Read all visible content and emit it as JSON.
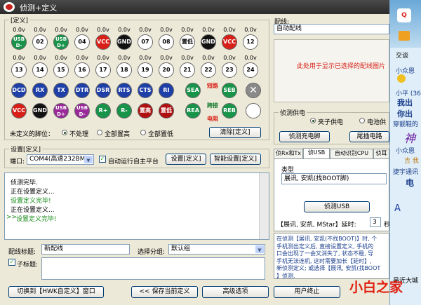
{
  "window": {
    "title": "侦测+定义",
    "close_label": "✕"
  },
  "define_group": {
    "legend": "[定义]"
  },
  "pins_row1": {
    "voltages": [
      "0.0v",
      "0.0v",
      "0.0v",
      "0.0v",
      "0.0v",
      "0.0v",
      "0.0v",
      "0.0v",
      "0.0v",
      "0.0v",
      "0.0v",
      "0.0v"
    ],
    "labels": [
      "USB\nD-",
      "02",
      "USB\nD+",
      "04",
      "VCC",
      "GND",
      "07",
      "08",
      "置低",
      "GND",
      "VCC",
      "12"
    ]
  },
  "pins_row2": {
    "voltages": [
      "0.0v",
      "0.0v",
      "0.0v",
      "0.0v",
      "0.0v",
      "0.0v",
      "0.0v",
      "0.0v",
      "0.0v",
      "0.0v",
      "0.0v",
      "0.0v"
    ],
    "labels": [
      "13",
      "14",
      "15",
      "16",
      "17",
      "18",
      "19",
      "20",
      "21",
      "22",
      "23",
      "24"
    ]
  },
  "signals_row1": [
    "DCD",
    "RX",
    "TX",
    "DTR",
    "DSR",
    "RTS",
    "CTS",
    "RI",
    "SEA",
    "SEB"
  ],
  "signals_row2": [
    "VCC",
    "GND",
    "USB\nD+",
    "USB\nD-",
    "R+",
    "R-",
    "置高",
    "置低",
    "REA",
    "REB"
  ],
  "badges": {
    "short": "短路",
    "bridge1": "跨接",
    "bridge2": "电阻"
  },
  "undefined_pins": {
    "label": "未定义的脚位：",
    "options": [
      "不处理",
      "全部置高",
      "全部置低"
    ],
    "selected": 0,
    "clear_button": "清除[定义]"
  },
  "settings": {
    "legend": "设置[定义]",
    "port_label": "端口:",
    "port_value": "COM4(高速232BM)",
    "auto_run_label": "自动运行自主平台",
    "set_button": "设置[定义]",
    "smart_button": "智能设置[定义]"
  },
  "log": [
    {
      "text": "侦测完毕.",
      "color": "#000000"
    },
    {
      "text": "正在设置定义...",
      "color": "#000000"
    },
    {
      "text": "设置定义完毕!",
      "color": "#1a8c1a"
    },
    {
      "text": "正在设置定义...",
      "color": "#000000"
    },
    {
      "text": "设置定义完毕!",
      "color": "#1a8c1a"
    }
  ],
  "log_prompt": ">>",
  "form": {
    "title_label": "配线标题:",
    "title_value": "新配线",
    "group_label": "选择分组:",
    "group_value": "默认组",
    "subtitle_label": "子标题:"
  },
  "bottom_buttons": {
    "switch": "切换到【HWK自定义】窗口",
    "save": "<< 保存当前定义",
    "advanced": "高级选项",
    "terminate": "用户终止"
  },
  "wiring": {
    "legend": "配线:",
    "value": "自动配线",
    "placeholder": "此处用于显示已选择的配线图片"
  },
  "power": {
    "legend": "侦测供电",
    "options": [
      "夹子供电",
      "电池供"
    ],
    "selected": 0,
    "detect_button": "侦测充电脚",
    "tail_button": "尾插电路"
  },
  "tabs": [
    "侦Rx和Tx",
    "侦USB",
    "自动识别CPU",
    "侦耳"
  ],
  "active_tab": 1,
  "usb_panel": {
    "type_label": "类型",
    "type_value": "展讯, 安凯(找BOOT脚)",
    "detect_button": "侦测USB",
    "delay_prefix": "【展讯, 安凯, MStar】延时:",
    "delay_value": "3",
    "delay_suffix": "秒"
  },
  "help_text": [
    "在侦测【展讯, 安凯(不找BOOT)】时, 个",
    "手机测出定义后, 直接设置定义, 手机的",
    "口会出现了一会又消失了, 状态不稳, 导",
    "手机无法连机, 这时需要加长【延时】,",
    "新侦测定义; 或选择【展讯, 安凯(找BOOT",
    "】侦测."
  ],
  "qq": {
    "line1": "交谈",
    "line2": "小众恩",
    "line3": "小平 (36",
    "line4": "我出",
    "line5": "你出",
    "line6": "穿靓鞋的",
    "line7": "神",
    "line8": "小众恩",
    "line9": "吉 我",
    "line10": "捷宇通讯",
    "line11": "电",
    "line12": "A",
    "line13": "最近大城",
    "avatar_label": "Q"
  },
  "watermark": "小白之家",
  "colors": {
    "accent": "#003c74",
    "green_text": "#1a8c1a",
    "red_text": "#d82018"
  }
}
